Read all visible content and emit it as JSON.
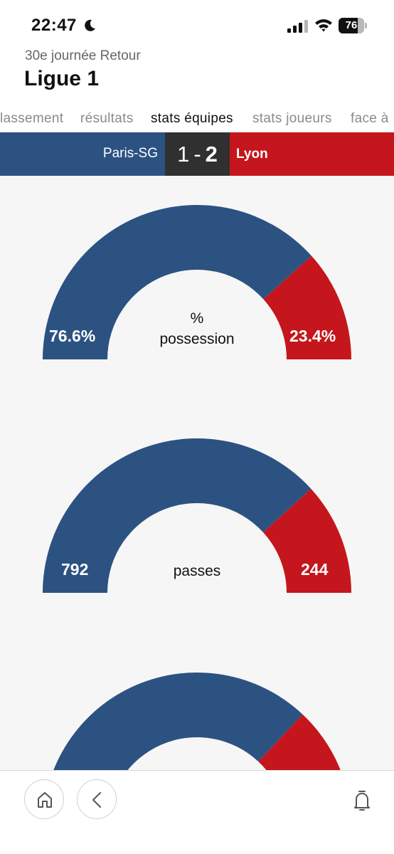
{
  "status_bar": {
    "time": "22:47",
    "battery_level": 76,
    "battery_text": "76",
    "icons": [
      "moon-icon",
      "signal-icon",
      "wifi-icon",
      "battery-icon"
    ]
  },
  "header": {
    "subtitle": "30e journée Retour",
    "title": "Ligue 1"
  },
  "tabs": [
    {
      "label": "lassement",
      "active": false
    },
    {
      "label": "résultats",
      "active": false
    },
    {
      "label": "stats équipes",
      "active": true
    },
    {
      "label": "stats joueurs",
      "active": false
    },
    {
      "label": "face à",
      "active": false
    }
  ],
  "match": {
    "home_team": "Paris-SG",
    "away_team": "Lyon",
    "home_score": "1",
    "separator": "-",
    "away_score": "2",
    "home_color": "#2c5282",
    "away_color": "#c4161c",
    "score_bg": "#303030"
  },
  "stats": [
    {
      "label_line1": "%",
      "label_line2": "possession",
      "home_text": "76.6%",
      "away_text": "23.4%",
      "home_value": 76.6,
      "away_value": 23.4
    },
    {
      "label_line1": "",
      "label_line2": "passes",
      "home_text": "792",
      "away_text": "244",
      "home_value": 792,
      "away_value": 244
    },
    {
      "label_line1": "",
      "label_line2": "",
      "home_text": "",
      "away_text": "",
      "home_value": 74,
      "away_value": 26
    }
  ],
  "toolbar": {
    "icons": [
      "home-icon",
      "back-icon",
      "bell-icon"
    ]
  }
}
